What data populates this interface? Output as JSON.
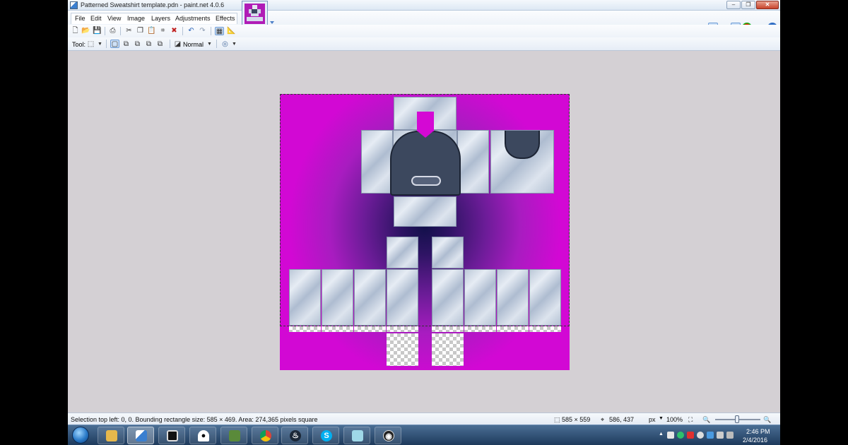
{
  "window": {
    "title": "Patterned Sweatshirt template.pdn - paint.net 4.0.6",
    "min": "–",
    "max": "❐",
    "close": "✕"
  },
  "menu": [
    "File",
    "Edit",
    "View",
    "Image",
    "Layers",
    "Adjustments",
    "Effects"
  ],
  "toolbar": {
    "tool_label": "Tool:",
    "blend_mode": "Normal"
  },
  "status": {
    "selection_info": "Selection top left: 0, 0. Bounding rectangle size: 585 × 469. Area: 274,365 pixels square",
    "image_size": "585 × 559",
    "cursor_position": "586, 437",
    "units": "px",
    "zoom": "100%"
  },
  "taskbar": {
    "apps": [
      "windows-explorer",
      "paint-net",
      "media-player",
      "ghost-app",
      "minecraft",
      "chrome",
      "steam",
      "skype",
      "notepad",
      "obs"
    ],
    "time": "2:46 PM",
    "date": "2/4/2016"
  },
  "colors": {
    "canvas_edge": "#d208d4",
    "canvas_center": "#12104a",
    "hood": "#3c485e"
  }
}
